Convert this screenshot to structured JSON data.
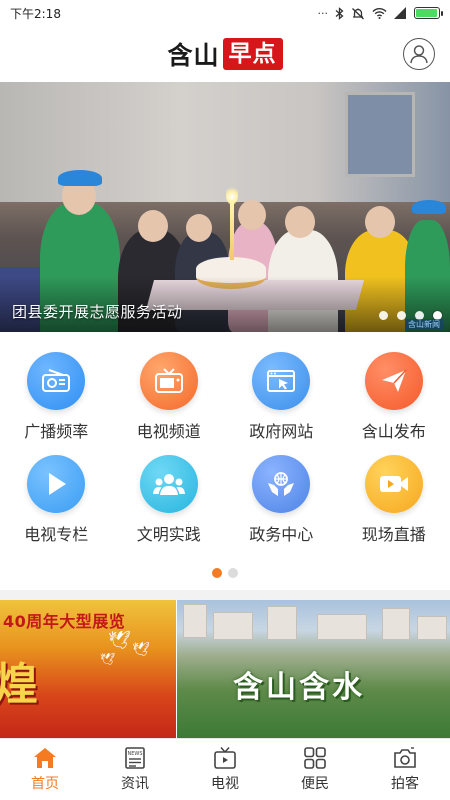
{
  "status_bar": {
    "time": "下午2:18",
    "icons": [
      "dots-icon",
      "bluetooth-icon",
      "mute-icon",
      "wifi-icon",
      "signal-icon",
      "battery-icon"
    ],
    "battery_level": 0.95
  },
  "header": {
    "logo_part1": "含山",
    "logo_part2": "早点",
    "logo_accent_color": "#d7161c",
    "profile_icon": "user-icon"
  },
  "banner": {
    "caption": "团县委开展志愿服务活动",
    "watermark": "含山新闻",
    "slide_count": 4,
    "active_slide": 4
  },
  "grid": {
    "items": [
      {
        "label": "广播频率",
        "icon": "radio-icon",
        "color": "#2f8ff2"
      },
      {
        "label": "电视频道",
        "icon": "tv-icon",
        "color": "#f4692a"
      },
      {
        "label": "政府网站",
        "icon": "web-icon",
        "color": "#3a8fea"
      },
      {
        "label": "含山发布",
        "icon": "paper-plane-icon",
        "color": "#f55a2a"
      },
      {
        "label": "电视专栏",
        "icon": "play-icon",
        "color": "#3a9df3"
      },
      {
        "label": "文明实践",
        "icon": "group-icon",
        "color": "#27b5de"
      },
      {
        "label": "政务中心",
        "icon": "hands-globe-icon",
        "color": "#4d84e5"
      },
      {
        "label": "现场直播",
        "icon": "video-camera-icon",
        "color": "#f6a71e"
      }
    ],
    "page_count": 2,
    "active_page": 1
  },
  "cards": {
    "expo": {
      "title": "40周年大型展览",
      "big_char": "煌"
    },
    "town": {
      "title": "含山含水"
    }
  },
  "tabbar": {
    "accent_color": "#f47b22",
    "items": [
      {
        "label": "首页",
        "icon": "home-icon",
        "active": true
      },
      {
        "label": "资讯",
        "icon": "news-icon",
        "active": false
      },
      {
        "label": "电视",
        "icon": "tv-icon",
        "active": false
      },
      {
        "label": "便民",
        "icon": "grid-icon",
        "active": false
      },
      {
        "label": "拍客",
        "icon": "camera-icon",
        "active": false
      }
    ]
  }
}
